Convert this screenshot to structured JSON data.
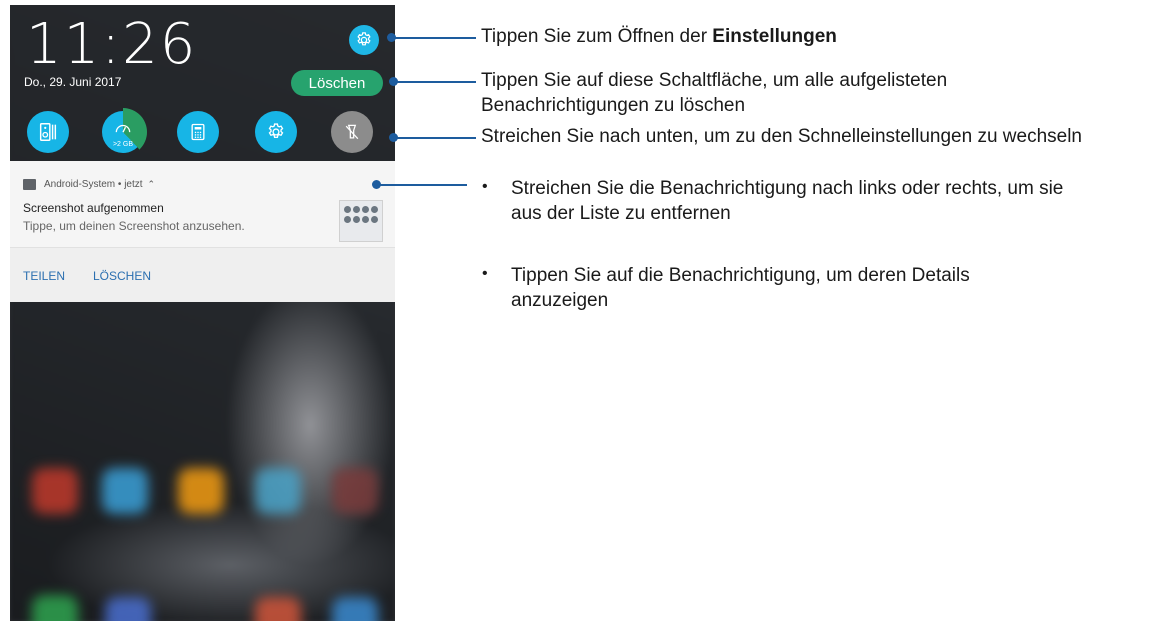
{
  "phone": {
    "clock": "11:26",
    "date": "Do., 29. Juni 2017",
    "clear_button_label": "Löschen",
    "settings_icon": "gear-icon",
    "quick_settings": [
      {
        "icon": "audio-wizard-icon"
      },
      {
        "icon": "boost-memory-icon",
        "label": ">2 GB"
      },
      {
        "icon": "calculator-icon"
      },
      {
        "icon": "settings-gear-icon"
      },
      {
        "icon": "flashlight-off-icon"
      }
    ],
    "notification": {
      "app": "Android-System",
      "time": "jetzt",
      "title": "Screenshot aufgenommen",
      "text": "Tippe, um deinen Screenshot anzusehen.",
      "actions": [
        "TEILEN",
        "LÖSCHEN"
      ]
    }
  },
  "callouts": {
    "settings_prefix": "Tippen Sie zum Öffnen der ",
    "settings_bold": "Einstellungen",
    "clear_line1": "Tippen Sie auf diese Schaltfläche, um alle aufgelisteten",
    "clear_line2": "Benachrichtigungen zu löschen",
    "quick_settings": "Streichen Sie nach unten, um zu den Schnelleinstellungen zu wechseln",
    "bullets": [
      {
        "line1": "Streichen Sie die Benachrichtigung nach links oder rechts, um sie",
        "line2": "aus der Liste zu entfernen"
      },
      {
        "line1": "Tippen Sie auf die Benachrichtigung, um deren Details",
        "line2": "anzuzeigen"
      }
    ]
  },
  "colors": {
    "accent_blue": "#17b5e6",
    "clear_green": "#27a36e",
    "leader_line": "#1d5c9e"
  }
}
